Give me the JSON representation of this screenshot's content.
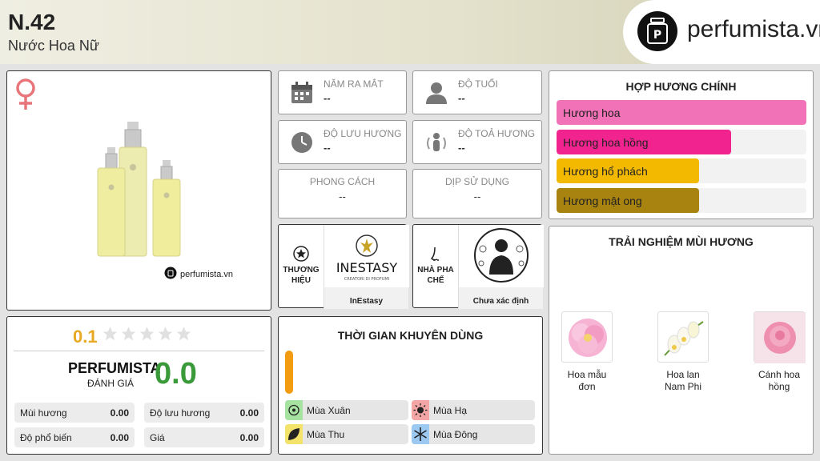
{
  "header": {
    "title": "N.42",
    "subtitle": "Nước Hoa Nữ",
    "logo_text": "perfumista.vn"
  },
  "product": {
    "watermark": "perfumista.vn",
    "gender_icon": "female-symbol-icon"
  },
  "info": {
    "release_year": {
      "label": "NĂM RA MẮT",
      "value": "--"
    },
    "age": {
      "label": "ĐỘ TUỔI",
      "value": "--"
    },
    "longevity": {
      "label": "ĐỘ LƯU HƯƠNG",
      "value": "--"
    },
    "sillage": {
      "label": "ĐỘ TOẢ HƯƠNG",
      "value": "--"
    },
    "style": {
      "label": "PHONG CÁCH",
      "value": "--"
    },
    "occasion": {
      "label": "DỊP SỬ DỤNG",
      "value": "--"
    }
  },
  "brand": {
    "side_label": "THƯƠNG HIỆU",
    "name": "InEstasy",
    "logo_text": "INESTASY",
    "logo_sub": "CREATORI DI PROFUMI"
  },
  "perfumer": {
    "side_label": "NHÀ PHA CHẾ",
    "name": "Chưa xác định"
  },
  "accords": {
    "title": "HỢP HƯƠNG CHÍNH",
    "items": [
      {
        "label": "Hương hoa",
        "percent": 100,
        "color": "#f272b8"
      },
      {
        "label": "Hương hoa hồng",
        "percent": 70,
        "color": "#f1238f"
      },
      {
        "label": "Hương hổ phách",
        "percent": 57,
        "color": "#f3b800"
      },
      {
        "label": "Hương mật ong",
        "percent": 57,
        "color": "#a88310"
      }
    ]
  },
  "notes": {
    "title": "TRẢI NGHIỆM MÙI HƯƠNG",
    "items": [
      {
        "label_1": "Hoa mẫu",
        "label_2": "đơn",
        "icon": "peony-image"
      },
      {
        "label_1": "Hoa lan",
        "label_2": "Nam Phi",
        "icon": "freesia-image"
      },
      {
        "label_1": "Cánh hoa",
        "label_2": "hồng",
        "icon": "rose-petal-image"
      }
    ]
  },
  "rating": {
    "score": "0.1",
    "stars": 0.1,
    "pf_label": "PERFUMISTA",
    "pf_sub": "ĐÁNH GIÁ",
    "pf_score": "0.0",
    "metrics": [
      {
        "label": "Mùi hương",
        "value": "0.00"
      },
      {
        "label": "Độ lưu hương",
        "value": "0.00"
      },
      {
        "label": "Độ phổ biến",
        "value": "0.00"
      },
      {
        "label": "Giá",
        "value": "0.00"
      }
    ]
  },
  "usage": {
    "title": "THỜI GIAN KHUYÊN DÙNG",
    "bar_level": 1,
    "bar_color": "#f39c12",
    "seasons": [
      {
        "label": "Mùa Xuân",
        "color": "#a6e3a1"
      },
      {
        "label": "Mùa Hạ",
        "color": "#f4a6a6"
      },
      {
        "label": "Mùa Thu",
        "color": "#f3e36b"
      },
      {
        "label": "Mùa Đông",
        "color": "#9cc9f2"
      }
    ]
  }
}
